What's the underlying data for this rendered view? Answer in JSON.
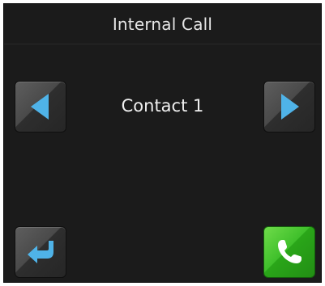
{
  "header": {
    "title": "Internal Call"
  },
  "contact": {
    "name": "Contact 1"
  },
  "colors": {
    "screen_bg": "#1b1b1b",
    "arrow_blue": "#4fb3e8",
    "call_green": "#3fbf2b"
  },
  "icons": {
    "prev": "left-arrow-icon",
    "next": "right-arrow-icon",
    "back": "back-arrow-icon",
    "call": "phone-icon"
  }
}
